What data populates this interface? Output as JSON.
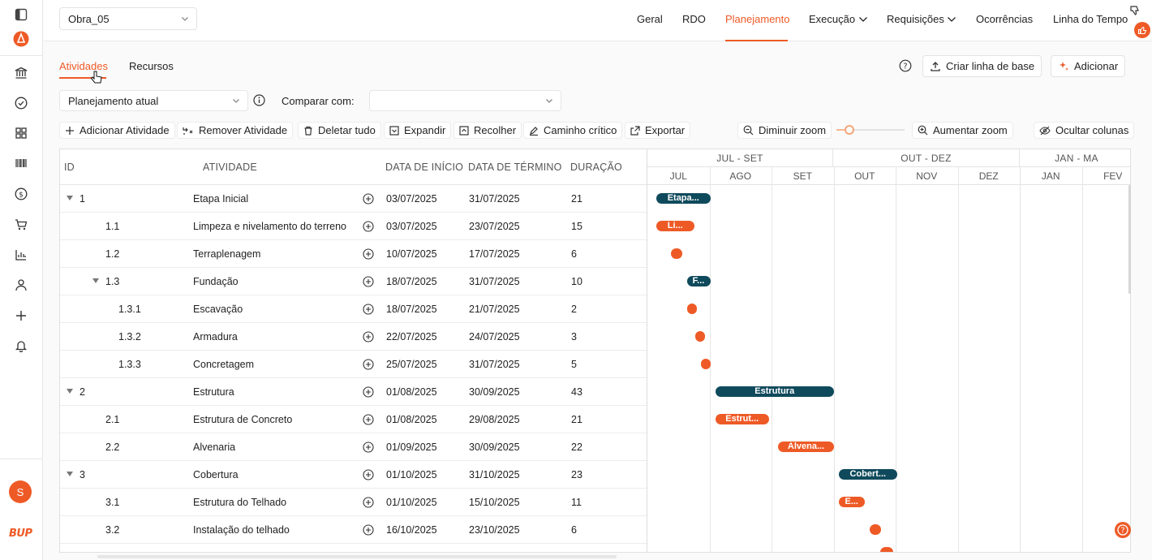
{
  "top": {
    "obra_select": "Obra_05",
    "nav": [
      "Geral",
      "RDO",
      "Planejamento",
      "Execução",
      "Requisições",
      "Ocorrências",
      "Linha do Tempo"
    ]
  },
  "subtabs": [
    "Atividades",
    "Recursos"
  ],
  "actions": {
    "baseline": "Criar linha de base",
    "add": "Adicionar"
  },
  "filters": {
    "plan_select": "Planejamento atual",
    "compare_label": "Comparar com:",
    "compare_value": ""
  },
  "toolbar": {
    "add_activity": "Adicionar Atividade",
    "remove_activity": "Remover Atividade",
    "delete_all": "Deletar tudo",
    "expand": "Expandir",
    "collapse": "Recolher",
    "critical_path": "Caminho crítico",
    "export": "Exportar",
    "zoom_out": "Diminuir zoom",
    "zoom_in": "Aumentar zoom",
    "hide_columns": "Ocultar colunas"
  },
  "columns": [
    "ID",
    "ATIVIDADE",
    "DATA DE INÍCIO",
    "DATA DE TÉRMINO",
    "DURAÇÃO"
  ],
  "rows": [
    {
      "id": "1",
      "name": "Etapa Inicial",
      "start": "03/07/2025",
      "end": "31/07/2025",
      "duration": "21"
    },
    {
      "id": "1.1",
      "name": "Limpeza e nivelamento do terreno",
      "start": "03/07/2025",
      "end": "23/07/2025",
      "duration": "15"
    },
    {
      "id": "1.2",
      "name": "Terraplenagem",
      "start": "10/07/2025",
      "end": "17/07/2025",
      "duration": "6"
    },
    {
      "id": "1.3",
      "name": "Fundação",
      "start": "18/07/2025",
      "end": "31/07/2025",
      "duration": "10"
    },
    {
      "id": "1.3.1",
      "name": "Escavação",
      "start": "18/07/2025",
      "end": "21/07/2025",
      "duration": "2"
    },
    {
      "id": "1.3.2",
      "name": "Armadura",
      "start": "22/07/2025",
      "end": "24/07/2025",
      "duration": "3"
    },
    {
      "id": "1.3.3",
      "name": "Concretagem",
      "start": "25/07/2025",
      "end": "31/07/2025",
      "duration": "5"
    },
    {
      "id": "2",
      "name": "Estrutura",
      "start": "01/08/2025",
      "end": "30/09/2025",
      "duration": "43"
    },
    {
      "id": "2.1",
      "name": "Estrutura de Concreto",
      "start": "01/08/2025",
      "end": "29/08/2025",
      "duration": "21"
    },
    {
      "id": "2.2",
      "name": "Alvenaria",
      "start": "01/09/2025",
      "end": "30/09/2025",
      "duration": "22"
    },
    {
      "id": "3",
      "name": "Cobertura",
      "start": "01/10/2025",
      "end": "31/10/2025",
      "duration": "23"
    },
    {
      "id": "3.1",
      "name": "Estrutura do Telhado",
      "start": "01/10/2025",
      "end": "15/10/2025",
      "duration": "11"
    },
    {
      "id": "3.2",
      "name": "Instalação do telhado",
      "start": "16/10/2025",
      "end": "23/10/2025",
      "duration": "6"
    }
  ],
  "gantt": {
    "quarters": [
      "JUL - SET",
      "OUT - DEZ",
      "JAN - MA"
    ],
    "months": [
      "JUL",
      "AGO",
      "SET",
      "OUT",
      "NOV",
      "DEZ",
      "JAN",
      "FEV"
    ],
    "bar_labels": [
      "Etapa...",
      "Li...",
      "",
      "F...",
      "",
      "",
      "",
      "Estrutura",
      "Estrut...",
      "Alvena...",
      "Cobert...",
      "E...",
      ""
    ]
  },
  "sidebar": {
    "avatar_initial": "S",
    "brand": "BUP"
  }
}
